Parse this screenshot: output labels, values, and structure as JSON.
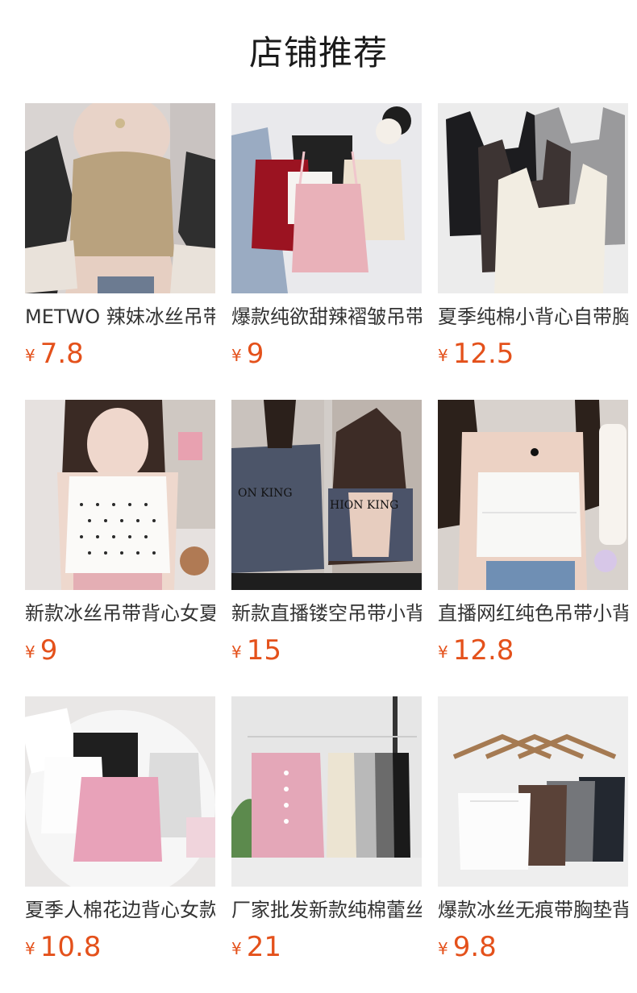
{
  "section": {
    "title": "店铺推荐"
  },
  "currency_symbol": "¥",
  "products": [
    {
      "name": "METWO 辣妹冰丝吊带背心",
      "price": "7.8",
      "image": "beige-cami-model-photo"
    },
    {
      "name": "爆款纯欲甜辣褶皱吊带背心",
      "price": "9",
      "image": "red-pink-white-camis-flatlay-photo"
    },
    {
      "name": "夏季纯棉小背心自带胸垫",
      "price": "12.5",
      "image": "black-brown-grey-white-tanks-photo"
    },
    {
      "name": "新款冰丝吊带背心女夏季",
      "price": "9",
      "image": "white-polka-dot-cami-model-photo"
    },
    {
      "name": "新款直播镂空吊带小背心",
      "price": "15",
      "image": "navy-backless-cami-model-photo"
    },
    {
      "name": "直播网红纯色吊带小背心",
      "price": "12.8",
      "image": "white-layered-cami-model-photo"
    },
    {
      "name": "夏季人棉花边背心女款",
      "price": "10.8",
      "image": "pink-lace-cami-flatlay-photo"
    },
    {
      "name": "厂家批发新款纯棉蕾丝背心",
      "price": "21",
      "image": "hanging-ribbed-camis-photo"
    },
    {
      "name": "爆款冰丝无痕带胸垫背心",
      "price": "9.8",
      "image": "hanging-padded-camis-photo"
    }
  ]
}
